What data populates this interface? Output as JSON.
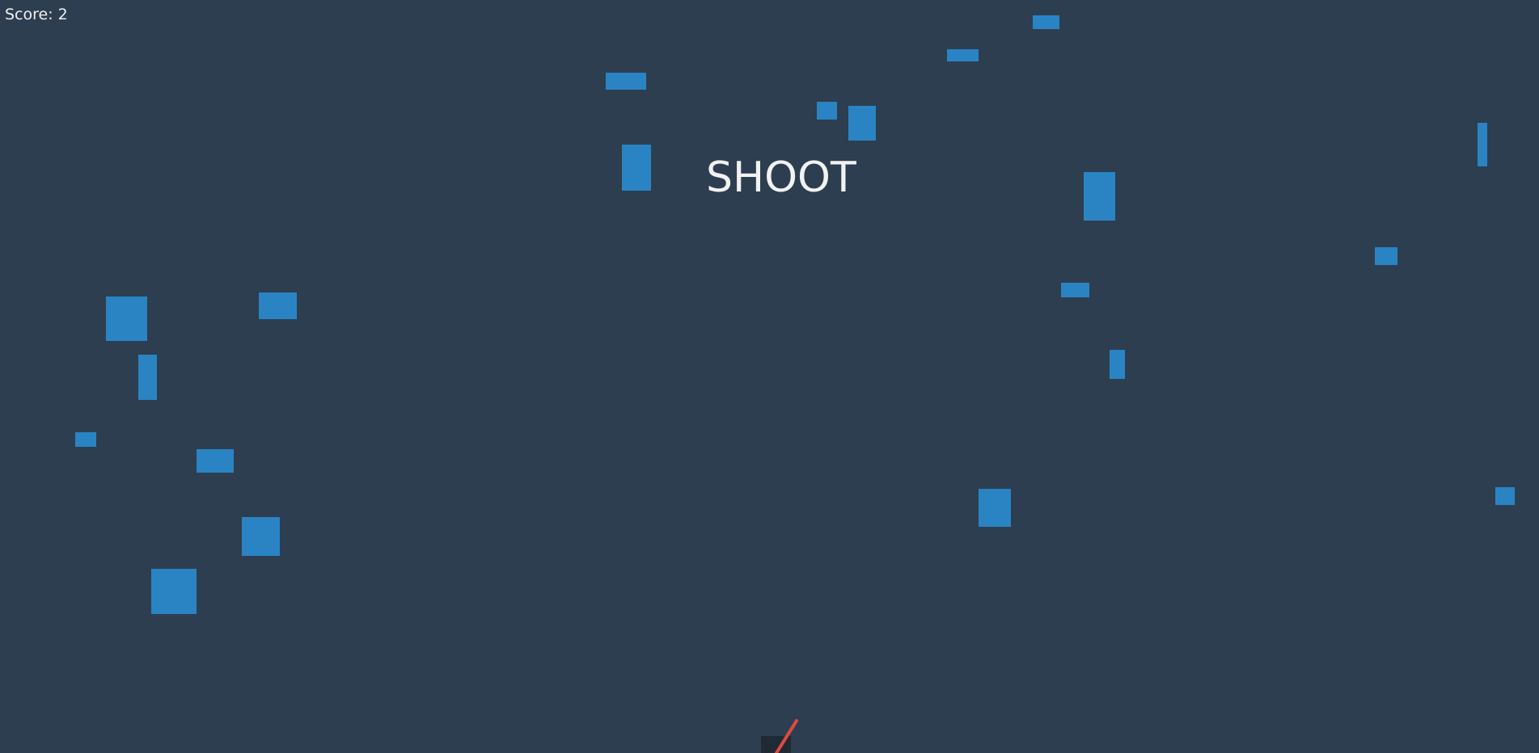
{
  "hud": {
    "score_text": "Score: 2"
  },
  "banner": {
    "text": "SHOOT"
  },
  "colors": {
    "background": "#2d3e50",
    "target": "#2a84c3",
    "barrel": "#e04a3f",
    "cannon_base": "#1f2a35",
    "text": "#f2f2f2"
  },
  "icons": {
    "cannon": "cannon-icon"
  }
}
